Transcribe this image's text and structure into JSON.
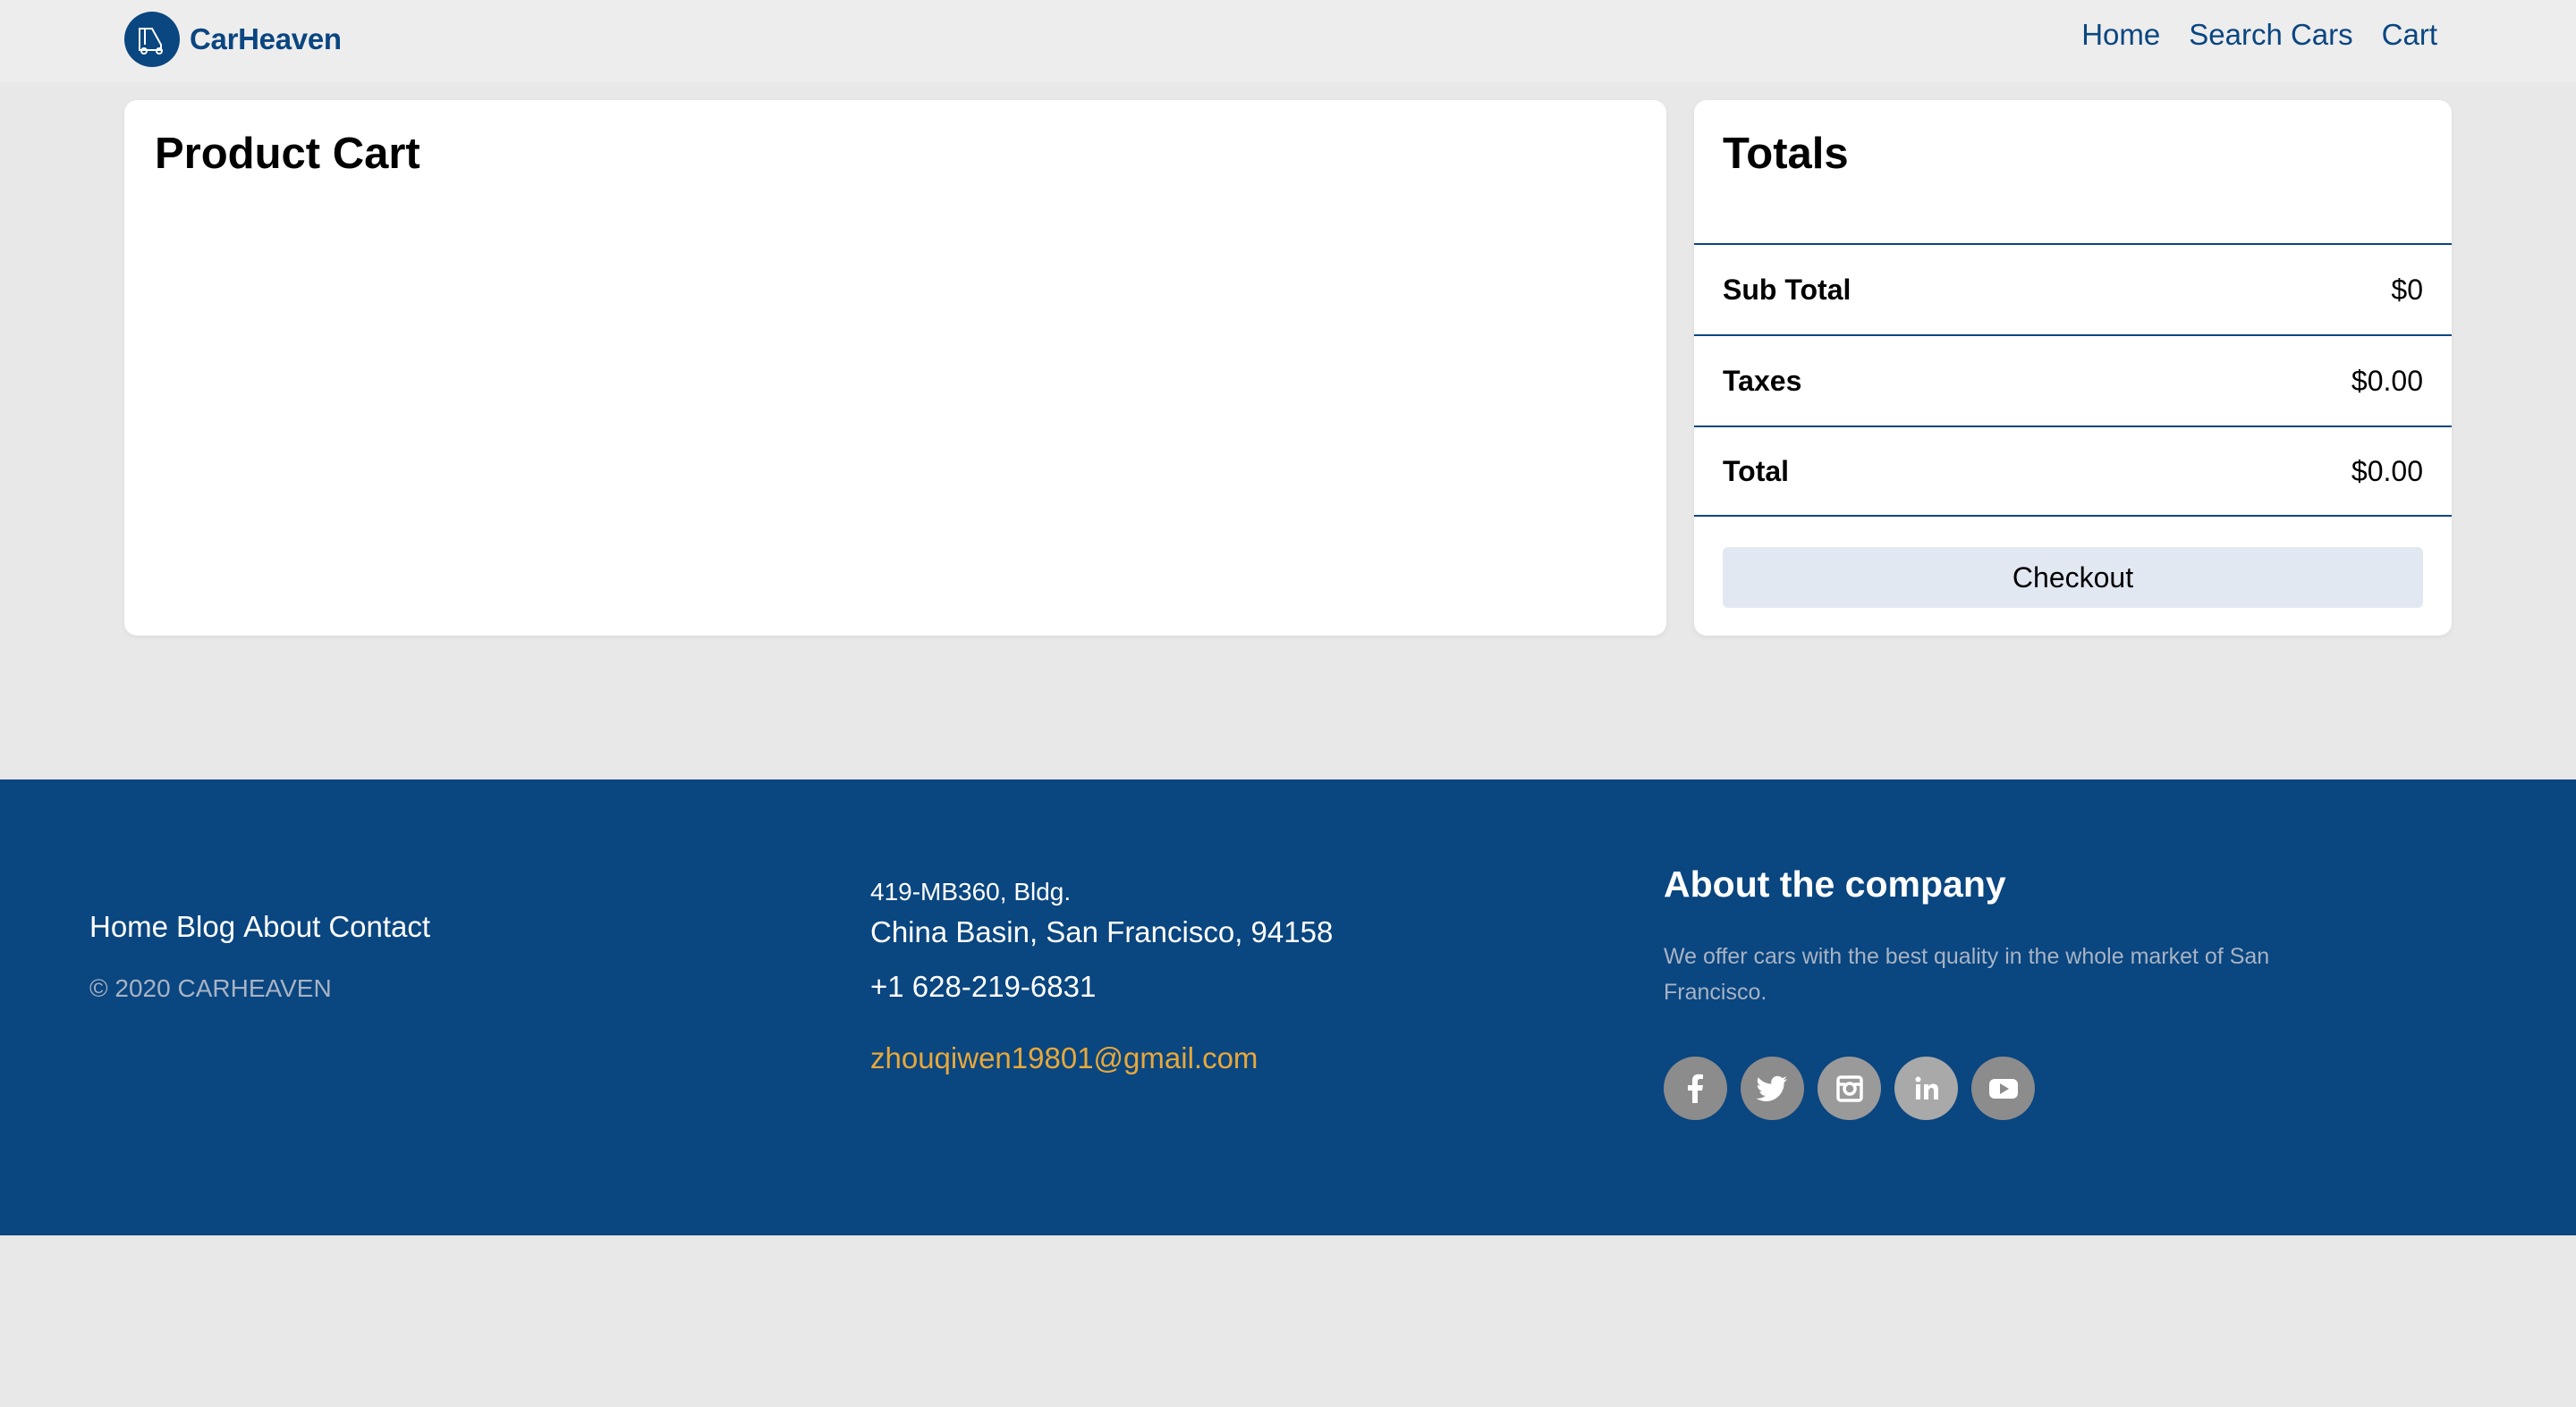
{
  "header": {
    "brand": "CarHeaven",
    "nav": [
      "Home",
      "Search Cars",
      "Cart"
    ]
  },
  "cart": {
    "title": "Product Cart"
  },
  "totals": {
    "title": "Totals",
    "rows": [
      {
        "label": "Sub Total",
        "value": "$0"
      },
      {
        "label": "Taxes",
        "value": "$0.00"
      },
      {
        "label": "Total",
        "value": "$0.00"
      }
    ],
    "checkout_label": "Checkout"
  },
  "footer": {
    "links": [
      "Home",
      "Blog",
      "About",
      "Contact"
    ],
    "copyright": "© 2020 CARHEAVEN",
    "address_line1": "419-MB360, Bldg.",
    "address_line2": "China Basin, San Francisco, 94158",
    "phone": "+1 628-219-6831",
    "email": "zhouqiwen19801@gmail.com",
    "about_title": "About the company",
    "about_text": "We offer cars with the best quality in the whole market of San Francisco.",
    "socials": [
      "facebook-icon",
      "twitter-icon",
      "instagram-icon",
      "linkedin-icon",
      "youtube-icon"
    ]
  },
  "colors": {
    "brand": "#0a4680",
    "accent_email": "#e8a83a",
    "background": "#e8e8e8",
    "button_bg": "#e2e8f2"
  }
}
